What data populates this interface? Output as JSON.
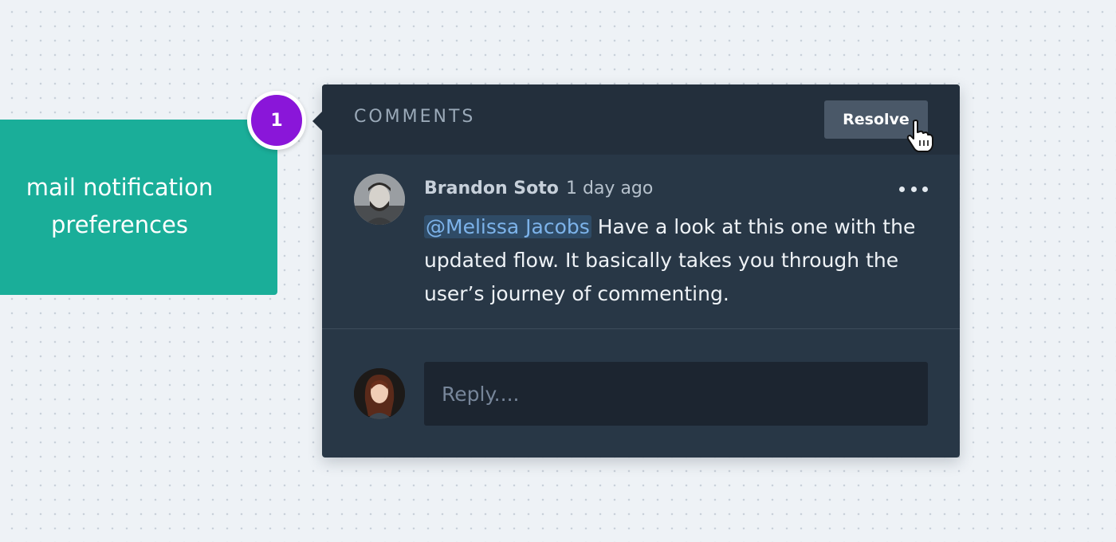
{
  "canvas": {
    "card": {
      "line1": "mail notification",
      "line2": "preferences"
    },
    "pin": {
      "number": "1"
    }
  },
  "comments_panel": {
    "title": "COMMENTS",
    "resolve_label": "Resolve",
    "comment": {
      "author": "Brandon Soto",
      "time": "1 day ago",
      "mention": "@Melissa Jacobs",
      "text": " Have a look at this one with the updated flow. It basically takes you through the user’s journey of commenting."
    },
    "reply": {
      "placeholder": "Reply....",
      "value": ""
    }
  },
  "colors": {
    "card_teal": "#1aae99",
    "pin_purple": "#8a16d9",
    "panel_bg": "#283746",
    "header_bg": "#232f3c",
    "mention_blue": "#7db3ea"
  },
  "icons": [
    "more-options-icon",
    "pointer-cursor-icon"
  ]
}
